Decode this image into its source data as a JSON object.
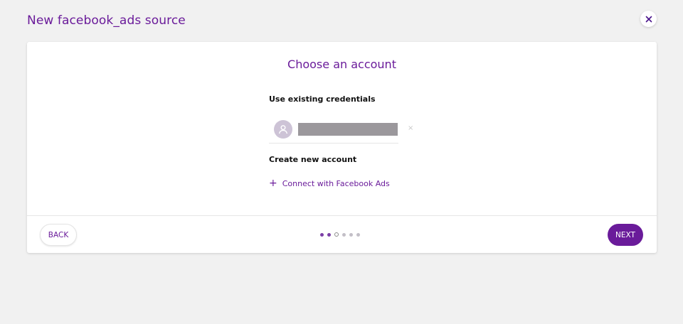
{
  "header": {
    "title": "New facebook_ads source"
  },
  "icons": {
    "close": "close-icon",
    "avatar": "user-icon",
    "remove": "remove-icon",
    "plus": "plus-icon"
  },
  "card": {
    "title": "Choose an account",
    "existing_label": "Use existing credentials",
    "remove_glyph": "×",
    "create_label": "Create new account",
    "connect": {
      "plus": "+",
      "label": "Connect with Facebook Ads"
    }
  },
  "footer": {
    "back_label": "BACK",
    "next_label": "NEXT",
    "steps": {
      "total": 6,
      "current": 3
    }
  },
  "colors": {
    "accent": "#6a1b9a",
    "background": "#f1f1f1",
    "redacted": "#9b989c"
  }
}
